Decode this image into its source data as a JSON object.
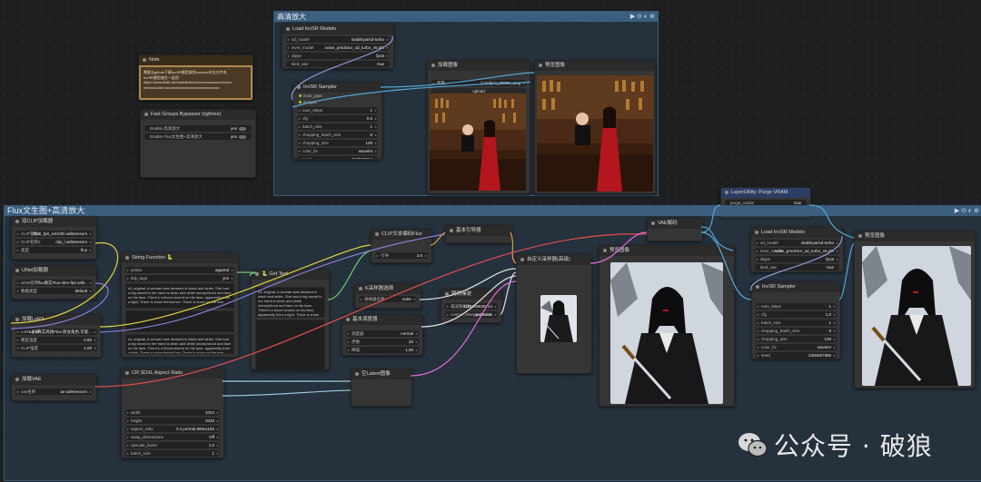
{
  "top_group": {
    "title": "高清放大",
    "icons": "▶ ⊙ ◐ ⊚",
    "nodes": {
      "loader": {
        "title": "Load InvSR Models",
        "widgets": [
          {
            "label": "sd_model",
            "value": "stabilityai/sd-turbo"
          },
          {
            "label": "invsr_model",
            "value": "noise_predictor_sd_turbo_v5.pth"
          },
          {
            "label": "dtype",
            "value": "fp16"
          },
          {
            "label": "tiled_vae",
            "value": "true"
          }
        ]
      },
      "sampler": {
        "title": "InvSR Sampler",
        "inputs": [
          "invsr_pipe",
          "images"
        ],
        "widgets": [
          {
            "label": "num_steps",
            "value": "1"
          },
          {
            "label": "cfg",
            "value": "0.0"
          },
          {
            "label": "batch_size",
            "value": "1"
          },
          {
            "label": "chopping_batch_size",
            "value": "8"
          },
          {
            "label": "chopping_size",
            "value": "128"
          },
          {
            "label": "color_fix",
            "value": "wavelet"
          },
          {
            "label": "seed",
            "value": "567867914"
          },
          {
            "label": "control_after_generate",
            "value": "randomize"
          }
        ]
      },
      "load_image": {
        "title": "加载图像",
        "widgets": [
          {
            "label": "图像",
            "value": "ComfyUI_00028_.png"
          }
        ],
        "upload": "upload"
      },
      "preview": {
        "title": "预览图像"
      }
    }
  },
  "note": {
    "title": "Note",
    "lines": [
      "需要去github下载InvSR模型放到comfyui对应文件夹",
      "",
      "InvSR模型放在一起用",
      "https://www.liblib.art/modelinfo/xxxxxxxxxxxxxxxxxxxxx",
      "versionUuid=xxxxxxxxxxxxxxxxxxxxxxxxxxxxxx"
    ]
  },
  "bypasser": {
    "title": "Fast Groups Bypasser (rgthree)",
    "rows": [
      {
        "label": "Enable 高清放大",
        "value": "yes"
      },
      {
        "label": "Enable Flux文生图+高清放大",
        "value": "yes"
      }
    ]
  },
  "bottom_group": {
    "title": "Flux文生图+高清放大",
    "icons": "▶ ⊙ ◐ ⊚",
    "nodes": {
      "dual_clip": {
        "title": "双CLIP加载器",
        "widgets": [
          {
            "label": "CLIP名称1",
            "value": "t5xxl_fp8_e4m3fn.safetensors"
          },
          {
            "label": "CLIP名称2",
            "value": "clip_l.safetensors"
          },
          {
            "label": "类型",
            "value": "flux"
          }
        ]
      },
      "unet": {
        "title": "UNet加载器",
        "widgets": [
          {
            "label": "UNet名称",
            "value": "flux真实Flux+dev-fp8.safe.."
          },
          {
            "label": "数据类型",
            "value": "default"
          }
        ]
      },
      "lora": {
        "title": "加载LoRA",
        "widgets": [
          {
            "label": "LoRA名称",
            "value": "Lora真实风格Flux.侠女角色.可爱..."
          },
          {
            "label": "模型强度",
            "value": "0.80"
          },
          {
            "label": "CLIP强度",
            "value": "1.00"
          }
        ]
      },
      "vae": {
        "title": "加载VAE",
        "widgets": [
          {
            "label": "vae名称",
            "value": "ae.safetensors"
          }
        ]
      },
      "string_fn": {
        "title": "String Function 🐍",
        "widgets": [
          {
            "label": "action",
            "value": "append"
          },
          {
            "label": "tidy_tags",
            "value": "yes"
          }
        ],
        "text1": "A1 original, A woman was dressed in black and white. She had a big sword in her hand a clean and white snowy.blood and face on his face. There's a blood wound on his face, apparently from a fight. There is snow behind her. There is snow on the tree.",
        "text3": "A1 original, A woman was dressed in black and white. She had a big sword in her hand a clean and white snowy.blood and face on his face. There's a blood wound on his face, apparently from a fight. There is snow behind her. There is snow on the tree."
      },
      "show_text": {
        "title": "🐍 Get Text",
        "text": "A1 original, A woman was dressed in black and white. She had a big sword in her hand a clean and white snowy.blood and face on his face. There's a blood wound on his face, apparently from a fight. There is snow behind her. There is snow on the tree."
      },
      "aspect": {
        "title": "CR SDXL Aspect Ratio",
        "widgets": [
          {
            "label": "width",
            "value": "1024"
          },
          {
            "label": "height",
            "value": "2048"
          },
          {
            "label": "aspect_ratio",
            "value": "3:4 portrait 896x1152"
          },
          {
            "label": "swap_dimensions",
            "value": "Off"
          },
          {
            "label": "upscale_factor",
            "value": "1.0"
          },
          {
            "label": "batch_size",
            "value": "1"
          }
        ]
      },
      "clip_encode": {
        "title": "CLIP文本编码Flux",
        "widgets": [
          {
            "label": "引导",
            "value": "3.5"
          }
        ]
      },
      "basic_guider": {
        "title": "基本引导器"
      },
      "ksampler_select": {
        "title": "K采样器选择",
        "widgets": [
          {
            "label": "采样器名称",
            "value": "euler"
          }
        ]
      },
      "random_noise": {
        "title": "随机噪波",
        "widgets": [
          {
            "label": "噪波随机种",
            "value": "1117106839714"
          },
          {
            "label": "control_after_generate",
            "value": "randomize"
          }
        ]
      },
      "scheduler": {
        "title": "基本调度器",
        "widgets": [
          {
            "label": "调度器",
            "value": "normal"
          },
          {
            "label": "步数",
            "value": "20"
          },
          {
            "label": "降噪",
            "value": "1.00"
          }
        ]
      },
      "empty_latent": {
        "title": "空Latent图像"
      },
      "custom_sampler": {
        "title": "自定义采样器(高级)"
      },
      "vae_decode": {
        "title": "VAE解码"
      },
      "preview1": {
        "title": "预览图像"
      },
      "invsr_loader": {
        "title": "Load InvSR Models",
        "widgets": [
          {
            "label": "sd_model",
            "value": "stabilityai/sd-turbo"
          },
          {
            "label": "invsr_model",
            "value": "noise_predictor_sd_turbo_v5.pth"
          },
          {
            "label": "dtype",
            "value": "fp16"
          },
          {
            "label": "tiled_vae",
            "value": "true"
          }
        ]
      },
      "invsr_sampler": {
        "title": "InvSR Sampler",
        "widgets": [
          {
            "label": "num_steps",
            "value": "1"
          },
          {
            "label": "cfg",
            "value": "1.0"
          },
          {
            "label": "batch_size",
            "value": "1"
          },
          {
            "label": "chopping_batch_size",
            "value": "8"
          },
          {
            "label": "chopping_size",
            "value": "128"
          },
          {
            "label": "color_fix",
            "value": "wavelet"
          },
          {
            "label": "seed",
            "value": "2300067998"
          },
          {
            "label": "control_after_generate",
            "value": "randomize"
          }
        ]
      },
      "preview2": {
        "title": "预览图像"
      }
    }
  },
  "purge_vram": {
    "title": "LayerUtility: Purge VRAM",
    "widgets": [
      {
        "label": "purge_cache",
        "value": "true"
      },
      {
        "label": "purge_models",
        "value": "true"
      }
    ]
  },
  "watermark": {
    "text": "公众号 · 破狼"
  },
  "colors": {
    "group_header": "#3c5f80",
    "node_bg": "#353535",
    "canvas": "#1e1f21",
    "note_border": "#b08850"
  }
}
